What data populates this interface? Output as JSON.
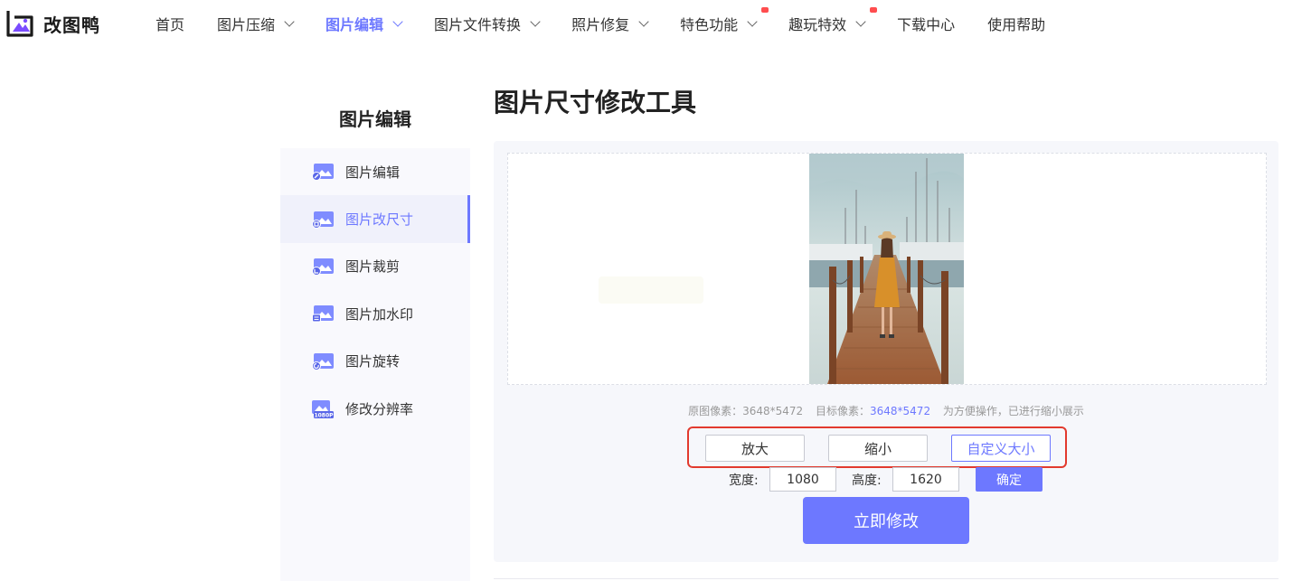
{
  "brand": {
    "name": "改图鸭"
  },
  "nav": {
    "items": [
      {
        "label": "首页"
      },
      {
        "label": "图片压缩"
      },
      {
        "label": "图片编辑"
      },
      {
        "label": "图片文件转换"
      },
      {
        "label": "照片修复"
      },
      {
        "label": "特色功能"
      },
      {
        "label": "趣玩特效"
      },
      {
        "label": "下载中心"
      },
      {
        "label": "使用帮助"
      }
    ]
  },
  "sidebar": {
    "title": "图片编辑",
    "items": [
      {
        "label": "图片编辑"
      },
      {
        "label": "图片改尺寸"
      },
      {
        "label": "图片裁剪"
      },
      {
        "label": "图片加水印"
      },
      {
        "label": "图片旋转"
      },
      {
        "label": "修改分辨率"
      }
    ],
    "resolution_badge": "1080P"
  },
  "main": {
    "title": "图片尺寸修改工具",
    "info": {
      "original_label": "原图像素：",
      "original_value": "3648*5472",
      "target_label": "目标像素：",
      "target_value": "3648*5472",
      "note": "为方便操作，已进行缩小展示"
    },
    "options": {
      "enlarge": "放大",
      "shrink": "缩小",
      "custom": "自定义大小"
    },
    "width_label": "宽度:",
    "width_value": "1080",
    "height_label": "高度:",
    "height_value": "1620",
    "confirm_label": "确定",
    "submit_label": "立即修改"
  },
  "colors": {
    "accent": "#6d78ff",
    "highlight_border": "#e23a2e",
    "badge": "#ff4d4f"
  }
}
